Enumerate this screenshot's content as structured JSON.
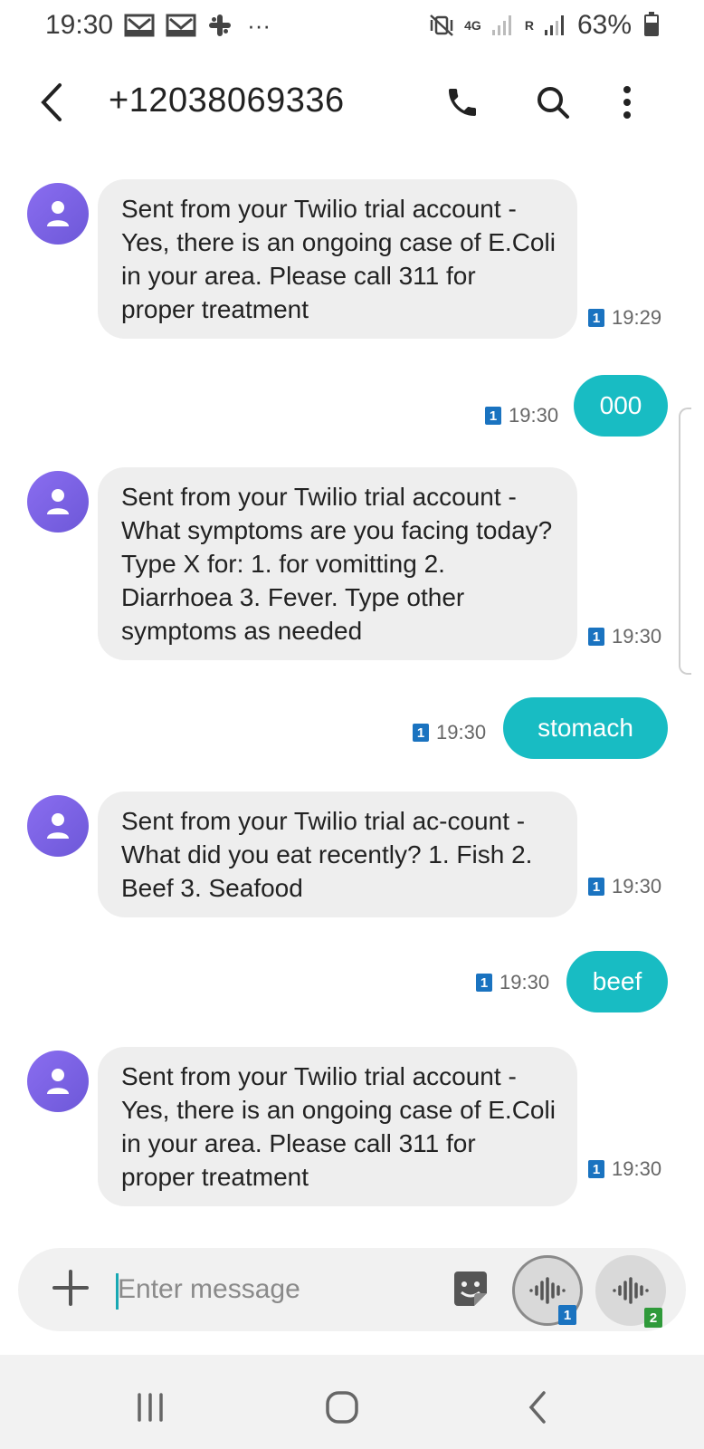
{
  "status_bar": {
    "time": "19:30",
    "notification_icons": [
      "gmail-icon",
      "gmail-icon",
      "slack-icon",
      "more-dots-icon"
    ],
    "more": "···",
    "network": "4G",
    "roaming": "R",
    "battery": "63%"
  },
  "header": {
    "contact": "+12038069336",
    "icons": [
      "back-icon",
      "phone-icon",
      "search-icon",
      "more-vert-icon"
    ]
  },
  "messages": [
    {
      "direction": "in",
      "text": "Sent from your Twilio trial account - Yes, there is an ongoing case of E.Coli in your area. Please call 311 for proper treatment",
      "sim": "1",
      "time": "19:29"
    },
    {
      "direction": "out",
      "text": "000",
      "sim": "1",
      "time": "19:30"
    },
    {
      "direction": "in",
      "text": "Sent from your Twilio trial account - What symptoms are you facing today? Type X for: 1. for vomitting 2. Diarrhoea 3. Fever. Type other symptoms as needed",
      "sim": "1",
      "time": "19:30"
    },
    {
      "direction": "out",
      "text": "stomach",
      "sim": "1",
      "time": "19:30"
    },
    {
      "direction": "in",
      "text": "Sent from your Twilio trial ac-count - What did you eat recently? 1. Fish 2. Beef 3. Seafood",
      "sim": "1",
      "time": "19:30"
    },
    {
      "direction": "out",
      "text": "beef",
      "sim": "1",
      "time": "19:30"
    },
    {
      "direction": "in",
      "text": "Sent from your Twilio trial account - Yes, there is an ongoing case of E.Coli in your area. Please call 311 for proper treatment",
      "sim": "1",
      "time": "19:30"
    }
  ],
  "composer": {
    "placeholder": "Enter message",
    "voice_sim_1": "1",
    "voice_sim_2": "2"
  },
  "colors": {
    "outgoing_bubble": "#18bcc3",
    "incoming_bubble": "#eeeeee",
    "avatar": "#7a63e4",
    "sim1_badge": "#1a73c0",
    "sim2_badge": "#2f9a3a"
  }
}
